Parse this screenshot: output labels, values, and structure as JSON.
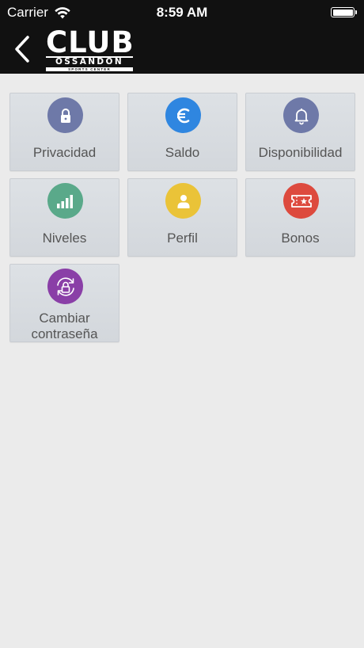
{
  "status_bar": {
    "carrier": "Carrier",
    "time": "8:59 AM"
  },
  "nav": {
    "logo_club": "CLUB",
    "logo_ossandon": "OSSANDON",
    "logo_tagline": "SPORTS CENTER"
  },
  "tiles": [
    {
      "label": "Privacidad",
      "icon": "lock-icon",
      "color": "#6e79a8"
    },
    {
      "label": "Saldo",
      "icon": "euro-icon",
      "color": "#2f86e0"
    },
    {
      "label": "Disponibilidad",
      "icon": "bell-icon",
      "color": "#6e79a8"
    },
    {
      "label": "Niveles",
      "icon": "signal-bars-icon",
      "color": "#5aa98a"
    },
    {
      "label": "Perfil",
      "icon": "user-icon",
      "color": "#eac338"
    },
    {
      "label": "Bonos",
      "icon": "ticket-icon",
      "color": "#dd4a3e"
    },
    {
      "label": "Cambiar\ncontraseña",
      "label_line1": "Cambiar",
      "label_line2": "contraseña",
      "icon": "lock-refresh-icon",
      "color": "#8a3fa7"
    }
  ]
}
